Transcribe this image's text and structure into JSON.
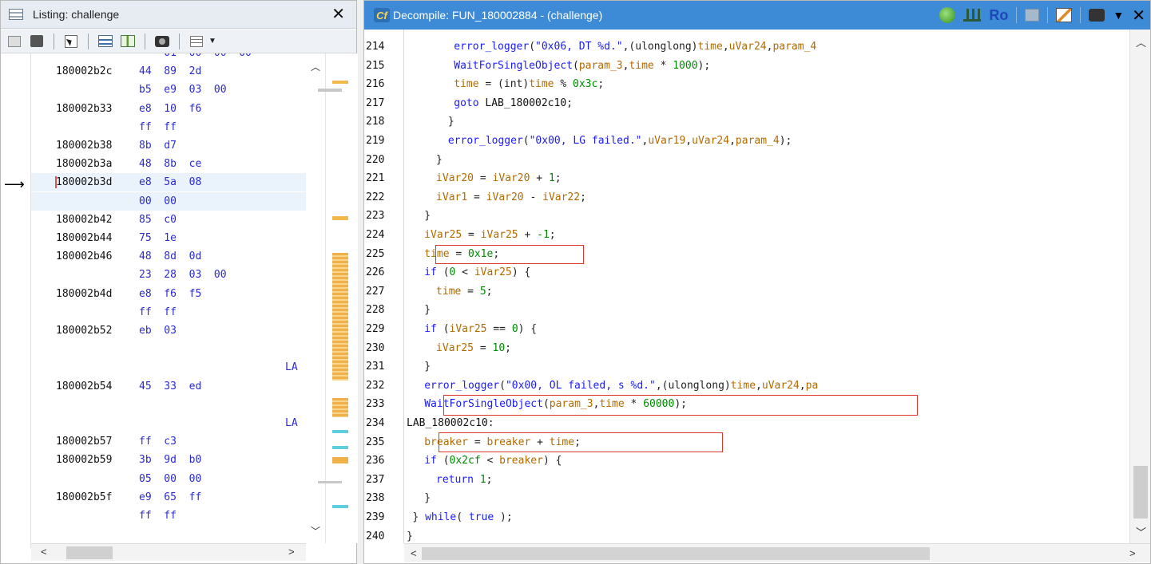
{
  "listing": {
    "title": "Listing:  challenge",
    "rows": [
      {
        "addr": "",
        "bytes": "    01  00  00  00",
        "partial": true
      },
      {
        "addr": "180002b2c",
        "bytes": "44  89  2d"
      },
      {
        "addr": "",
        "bytes": "b5  e9  03  00"
      },
      {
        "addr": "180002b33",
        "bytes": "e8  10  f6"
      },
      {
        "addr": "",
        "bytes": "ff  ff"
      },
      {
        "addr": "180002b38",
        "bytes": "8b  d7"
      },
      {
        "addr": "180002b3a",
        "bytes": "48  8b  ce"
      },
      {
        "addr": "180002b3d",
        "bytes": "e8  5a  08"
      },
      {
        "addr": "",
        "bytes": "00  00"
      },
      {
        "addr": "180002b42",
        "bytes": "85  c0"
      },
      {
        "addr": "180002b44",
        "bytes": "75  1e"
      },
      {
        "addr": "180002b46",
        "bytes": "48  8d  0d"
      },
      {
        "addr": "",
        "bytes": "23  28  03  00"
      },
      {
        "addr": "180002b4d",
        "bytes": "e8  f6  f5"
      },
      {
        "addr": "",
        "bytes": "ff  ff"
      },
      {
        "addr": "180002b52",
        "bytes": "eb  03"
      },
      {
        "addr": "",
        "bytes": ""
      },
      {
        "addr": "",
        "bytes": "",
        "label": "LA"
      },
      {
        "addr": "180002b54",
        "bytes": "45  33  ed"
      },
      {
        "addr": "",
        "bytes": ""
      },
      {
        "addr": "",
        "bytes": "",
        "label": "LA"
      },
      {
        "addr": "180002b57",
        "bytes": "ff  c3"
      },
      {
        "addr": "180002b59",
        "bytes": "3b  9d  b0"
      },
      {
        "addr": "",
        "bytes": "05  00  00"
      },
      {
        "addr": "180002b5f",
        "bytes": "e9  65  ff"
      },
      {
        "addr": "",
        "bytes": "ff  ff"
      }
    ]
  },
  "decompile": {
    "title": "Decompile: FUN_180002884 -  (challenge)",
    "ro_label": "Ro",
    "lines": [
      {
        "ln": "214",
        "indent": 8,
        "tokens": [
          [
            "f",
            "error_logger"
          ],
          [
            "p",
            "("
          ],
          [
            "s",
            "\"0x06, DT %d.\""
          ],
          [
            "p",
            ",(ulonglong)"
          ],
          [
            "v",
            "time"
          ],
          [
            "p",
            ","
          ],
          [
            "v",
            "uVar24"
          ],
          [
            "p",
            ","
          ],
          [
            "v",
            "param_4"
          ]
        ]
      },
      {
        "ln": "215",
        "indent": 8,
        "tokens": [
          [
            "f",
            "WaitForSingleObject"
          ],
          [
            "p",
            "("
          ],
          [
            "v",
            "param_3"
          ],
          [
            "p",
            ","
          ],
          [
            "v",
            "time"
          ],
          [
            "p",
            " * "
          ],
          [
            "n",
            "1000"
          ],
          [
            "p",
            ");"
          ]
        ]
      },
      {
        "ln": "216",
        "indent": 8,
        "tokens": [
          [
            "v",
            "time"
          ],
          [
            "p",
            " = (int)"
          ],
          [
            "v",
            "time"
          ],
          [
            "p",
            " % "
          ],
          [
            "n",
            "0x3c"
          ],
          [
            "p",
            ";"
          ]
        ]
      },
      {
        "ln": "217",
        "indent": 8,
        "tokens": [
          [
            "k",
            "goto"
          ],
          [
            "lab",
            " LAB_180002c10"
          ],
          [
            "p",
            ";"
          ]
        ]
      },
      {
        "ln": "218",
        "indent": 7,
        "tokens": [
          [
            "p",
            "}"
          ]
        ]
      },
      {
        "ln": "219",
        "indent": 7,
        "tokens": [
          [
            "f",
            "error_logger"
          ],
          [
            "p",
            "("
          ],
          [
            "s",
            "\"0x00, LG failed.\""
          ],
          [
            "p",
            ","
          ],
          [
            "v",
            "uVar19"
          ],
          [
            "p",
            ","
          ],
          [
            "v",
            "uVar24"
          ],
          [
            "p",
            ","
          ],
          [
            "v",
            "param_4"
          ],
          [
            "p",
            ");"
          ]
        ]
      },
      {
        "ln": "220",
        "indent": 5,
        "tokens": [
          [
            "p",
            "}"
          ]
        ]
      },
      {
        "ln": "221",
        "indent": 5,
        "tokens": [
          [
            "v",
            "iVar20"
          ],
          [
            "p",
            " = "
          ],
          [
            "v",
            "iVar20"
          ],
          [
            "p",
            " + "
          ],
          [
            "n",
            "1"
          ],
          [
            "p",
            ";"
          ]
        ]
      },
      {
        "ln": "222",
        "indent": 5,
        "tokens": [
          [
            "v",
            "iVar1"
          ],
          [
            "p",
            " = "
          ],
          [
            "v",
            "iVar20"
          ],
          [
            "p",
            " - "
          ],
          [
            "v",
            "iVar22"
          ],
          [
            "p",
            ";"
          ]
        ]
      },
      {
        "ln": "223",
        "indent": 3,
        "tokens": [
          [
            "p",
            "}"
          ]
        ]
      },
      {
        "ln": "224",
        "indent": 3,
        "tokens": [
          [
            "v",
            "iVar25"
          ],
          [
            "p",
            " = "
          ],
          [
            "v",
            "iVar25"
          ],
          [
            "p",
            " + "
          ],
          [
            "n",
            "-1"
          ],
          [
            "p",
            ";"
          ]
        ]
      },
      {
        "ln": "225",
        "indent": 3,
        "tokens": [
          [
            "v",
            "time"
          ],
          [
            "p",
            " = "
          ],
          [
            "n",
            "0x1e"
          ],
          [
            "p",
            ";"
          ]
        ]
      },
      {
        "ln": "226",
        "indent": 3,
        "tokens": [
          [
            "k",
            "if"
          ],
          [
            "p",
            " ("
          ],
          [
            "n",
            "0"
          ],
          [
            "p",
            " < "
          ],
          [
            "v",
            "iVar25"
          ],
          [
            "p",
            ") {"
          ]
        ]
      },
      {
        "ln": "227",
        "indent": 5,
        "tokens": [
          [
            "v",
            "time"
          ],
          [
            "p",
            " = "
          ],
          [
            "n",
            "5"
          ],
          [
            "p",
            ";"
          ]
        ]
      },
      {
        "ln": "228",
        "indent": 3,
        "tokens": [
          [
            "p",
            "}"
          ]
        ]
      },
      {
        "ln": "229",
        "indent": 3,
        "tokens": [
          [
            "k",
            "if"
          ],
          [
            "p",
            " ("
          ],
          [
            "v",
            "iVar25"
          ],
          [
            "p",
            " == "
          ],
          [
            "n",
            "0"
          ],
          [
            "p",
            ") {"
          ]
        ]
      },
      {
        "ln": "230",
        "indent": 5,
        "tokens": [
          [
            "v",
            "iVar25"
          ],
          [
            "p",
            " = "
          ],
          [
            "n",
            "10"
          ],
          [
            "p",
            ";"
          ]
        ]
      },
      {
        "ln": "231",
        "indent": 3,
        "tokens": [
          [
            "p",
            "}"
          ]
        ]
      },
      {
        "ln": "232",
        "indent": 3,
        "tokens": [
          [
            "f",
            "error_logger"
          ],
          [
            "p",
            "("
          ],
          [
            "s",
            "\"0x00, OL failed, s %d.\""
          ],
          [
            "p",
            ",(ulonglong)"
          ],
          [
            "v",
            "time"
          ],
          [
            "p",
            ","
          ],
          [
            "v",
            "uVar24"
          ],
          [
            "p",
            ","
          ],
          [
            "v",
            "pa"
          ]
        ]
      },
      {
        "ln": "233",
        "indent": 3,
        "tokens": [
          [
            "f",
            "WaitForSingleObject"
          ],
          [
            "p",
            "("
          ],
          [
            "v",
            "param_3"
          ],
          [
            "p",
            ","
          ],
          [
            "v",
            "time"
          ],
          [
            "p",
            " * "
          ],
          [
            "n",
            "60000"
          ],
          [
            "p",
            ");"
          ]
        ]
      },
      {
        "ln": "234",
        "indent": 0,
        "tokens": [
          [
            "lab",
            "LAB_180002c10"
          ],
          [
            "p",
            ":"
          ]
        ]
      },
      {
        "ln": "235",
        "indent": 3,
        "tokens": [
          [
            "v",
            "breaker"
          ],
          [
            "p",
            " = "
          ],
          [
            "v",
            "breaker"
          ],
          [
            "p",
            " + "
          ],
          [
            "v",
            "time"
          ],
          [
            "p",
            ";"
          ]
        ]
      },
      {
        "ln": "236",
        "indent": 3,
        "tokens": [
          [
            "k",
            "if"
          ],
          [
            "p",
            " ("
          ],
          [
            "n",
            "0x2cf"
          ],
          [
            "p",
            " < "
          ],
          [
            "v",
            "breaker"
          ],
          [
            "p",
            ") {"
          ]
        ]
      },
      {
        "ln": "237",
        "indent": 5,
        "tokens": [
          [
            "k",
            "return"
          ],
          [
            "p",
            " "
          ],
          [
            "n",
            "1"
          ],
          [
            "p",
            ";"
          ]
        ]
      },
      {
        "ln": "238",
        "indent": 3,
        "tokens": [
          [
            "p",
            "}"
          ]
        ]
      },
      {
        "ln": "239",
        "indent": 1,
        "tokens": [
          [
            "p",
            "} "
          ],
          [
            "k",
            "while"
          ],
          [
            "p",
            "( "
          ],
          [
            "k",
            "true"
          ],
          [
            "p",
            " );"
          ]
        ]
      },
      {
        "ln": "240",
        "indent": 0,
        "tokens": [
          [
            "p",
            "}"
          ]
        ]
      }
    ]
  }
}
